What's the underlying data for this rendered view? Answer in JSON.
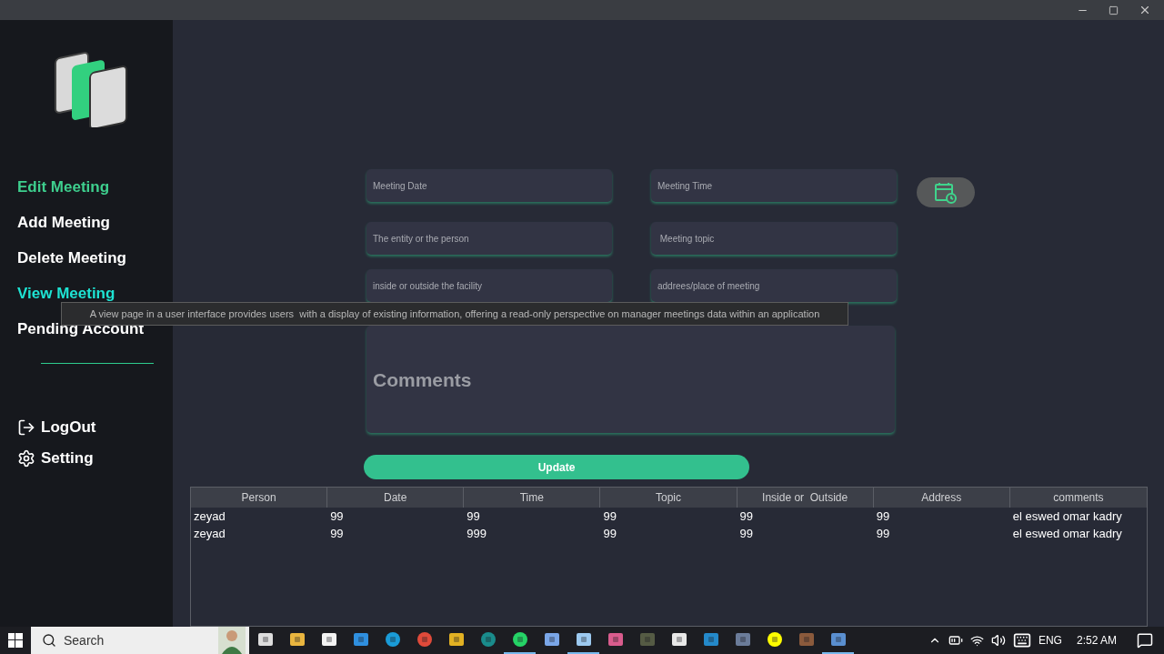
{
  "sidebar": {
    "nav": [
      {
        "label": "Edit Meeting",
        "selected": true,
        "hovered": false
      },
      {
        "label": "Add Meeting",
        "selected": false,
        "hovered": false
      },
      {
        "label": "Delete Meeting",
        "selected": false,
        "hovered": false
      },
      {
        "label": "View Meeting",
        "selected": false,
        "hovered": true
      },
      {
        "label": "Pending Account",
        "selected": false,
        "hovered": false
      }
    ],
    "actions": [
      {
        "label": "LogOut",
        "kind": "logout"
      },
      {
        "label": "Setting",
        "kind": "settings"
      }
    ]
  },
  "tooltip": "A view page in a user interface provides users  with a display of existing information, offering a read-only perspective on manager meetings data within an application",
  "form": {
    "fields": [
      {
        "placeholder": "Meeting Date"
      },
      {
        "placeholder": "Meeting Time"
      },
      {
        "placeholder": "The entity or the person"
      },
      {
        "placeholder": " Meeting topic"
      },
      {
        "placeholder": "inside or outside the facility"
      },
      {
        "placeholder": "addrees/place of meeting"
      }
    ],
    "comments": {
      "placeholder": "Comments"
    },
    "button": "Update"
  },
  "table": {
    "columns": [
      "Person",
      "Date",
      "Time",
      "Topic",
      "Inside or  Outside",
      "Address",
      "comments"
    ],
    "rows": [
      [
        "zeyad",
        "99",
        "99",
        "99",
        "99",
        "99",
        "el eswed omar kadry"
      ],
      [
        "zeyad",
        "99",
        "999",
        "99",
        "99",
        "99",
        "el eswed omar kadry"
      ]
    ]
  },
  "taskbar": {
    "search": {
      "placeholder": "Search"
    },
    "apps": [
      {
        "kind": "taskview",
        "running": false
      },
      {
        "kind": "folder",
        "running": false
      },
      {
        "kind": "store",
        "running": false
      },
      {
        "kind": "mail",
        "running": false
      },
      {
        "kind": "edge",
        "running": false
      },
      {
        "kind": "chrome",
        "running": false
      },
      {
        "kind": "puzzle",
        "running": false
      },
      {
        "kind": "arduino",
        "running": false
      },
      {
        "kind": "whatsapp",
        "running": true
      },
      {
        "kind": "media",
        "running": false
      },
      {
        "kind": "cube",
        "running": true
      },
      {
        "kind": "box",
        "running": false
      },
      {
        "kind": "console",
        "running": false
      },
      {
        "kind": "b",
        "running": false
      },
      {
        "kind": "vscode",
        "running": false
      },
      {
        "kind": "game",
        "running": false
      },
      {
        "kind": "ghost",
        "running": false
      },
      {
        "kind": "photo",
        "running": false
      },
      {
        "kind": "java",
        "running": true
      }
    ],
    "language": "ENG",
    "time": "2:52 AM"
  }
}
